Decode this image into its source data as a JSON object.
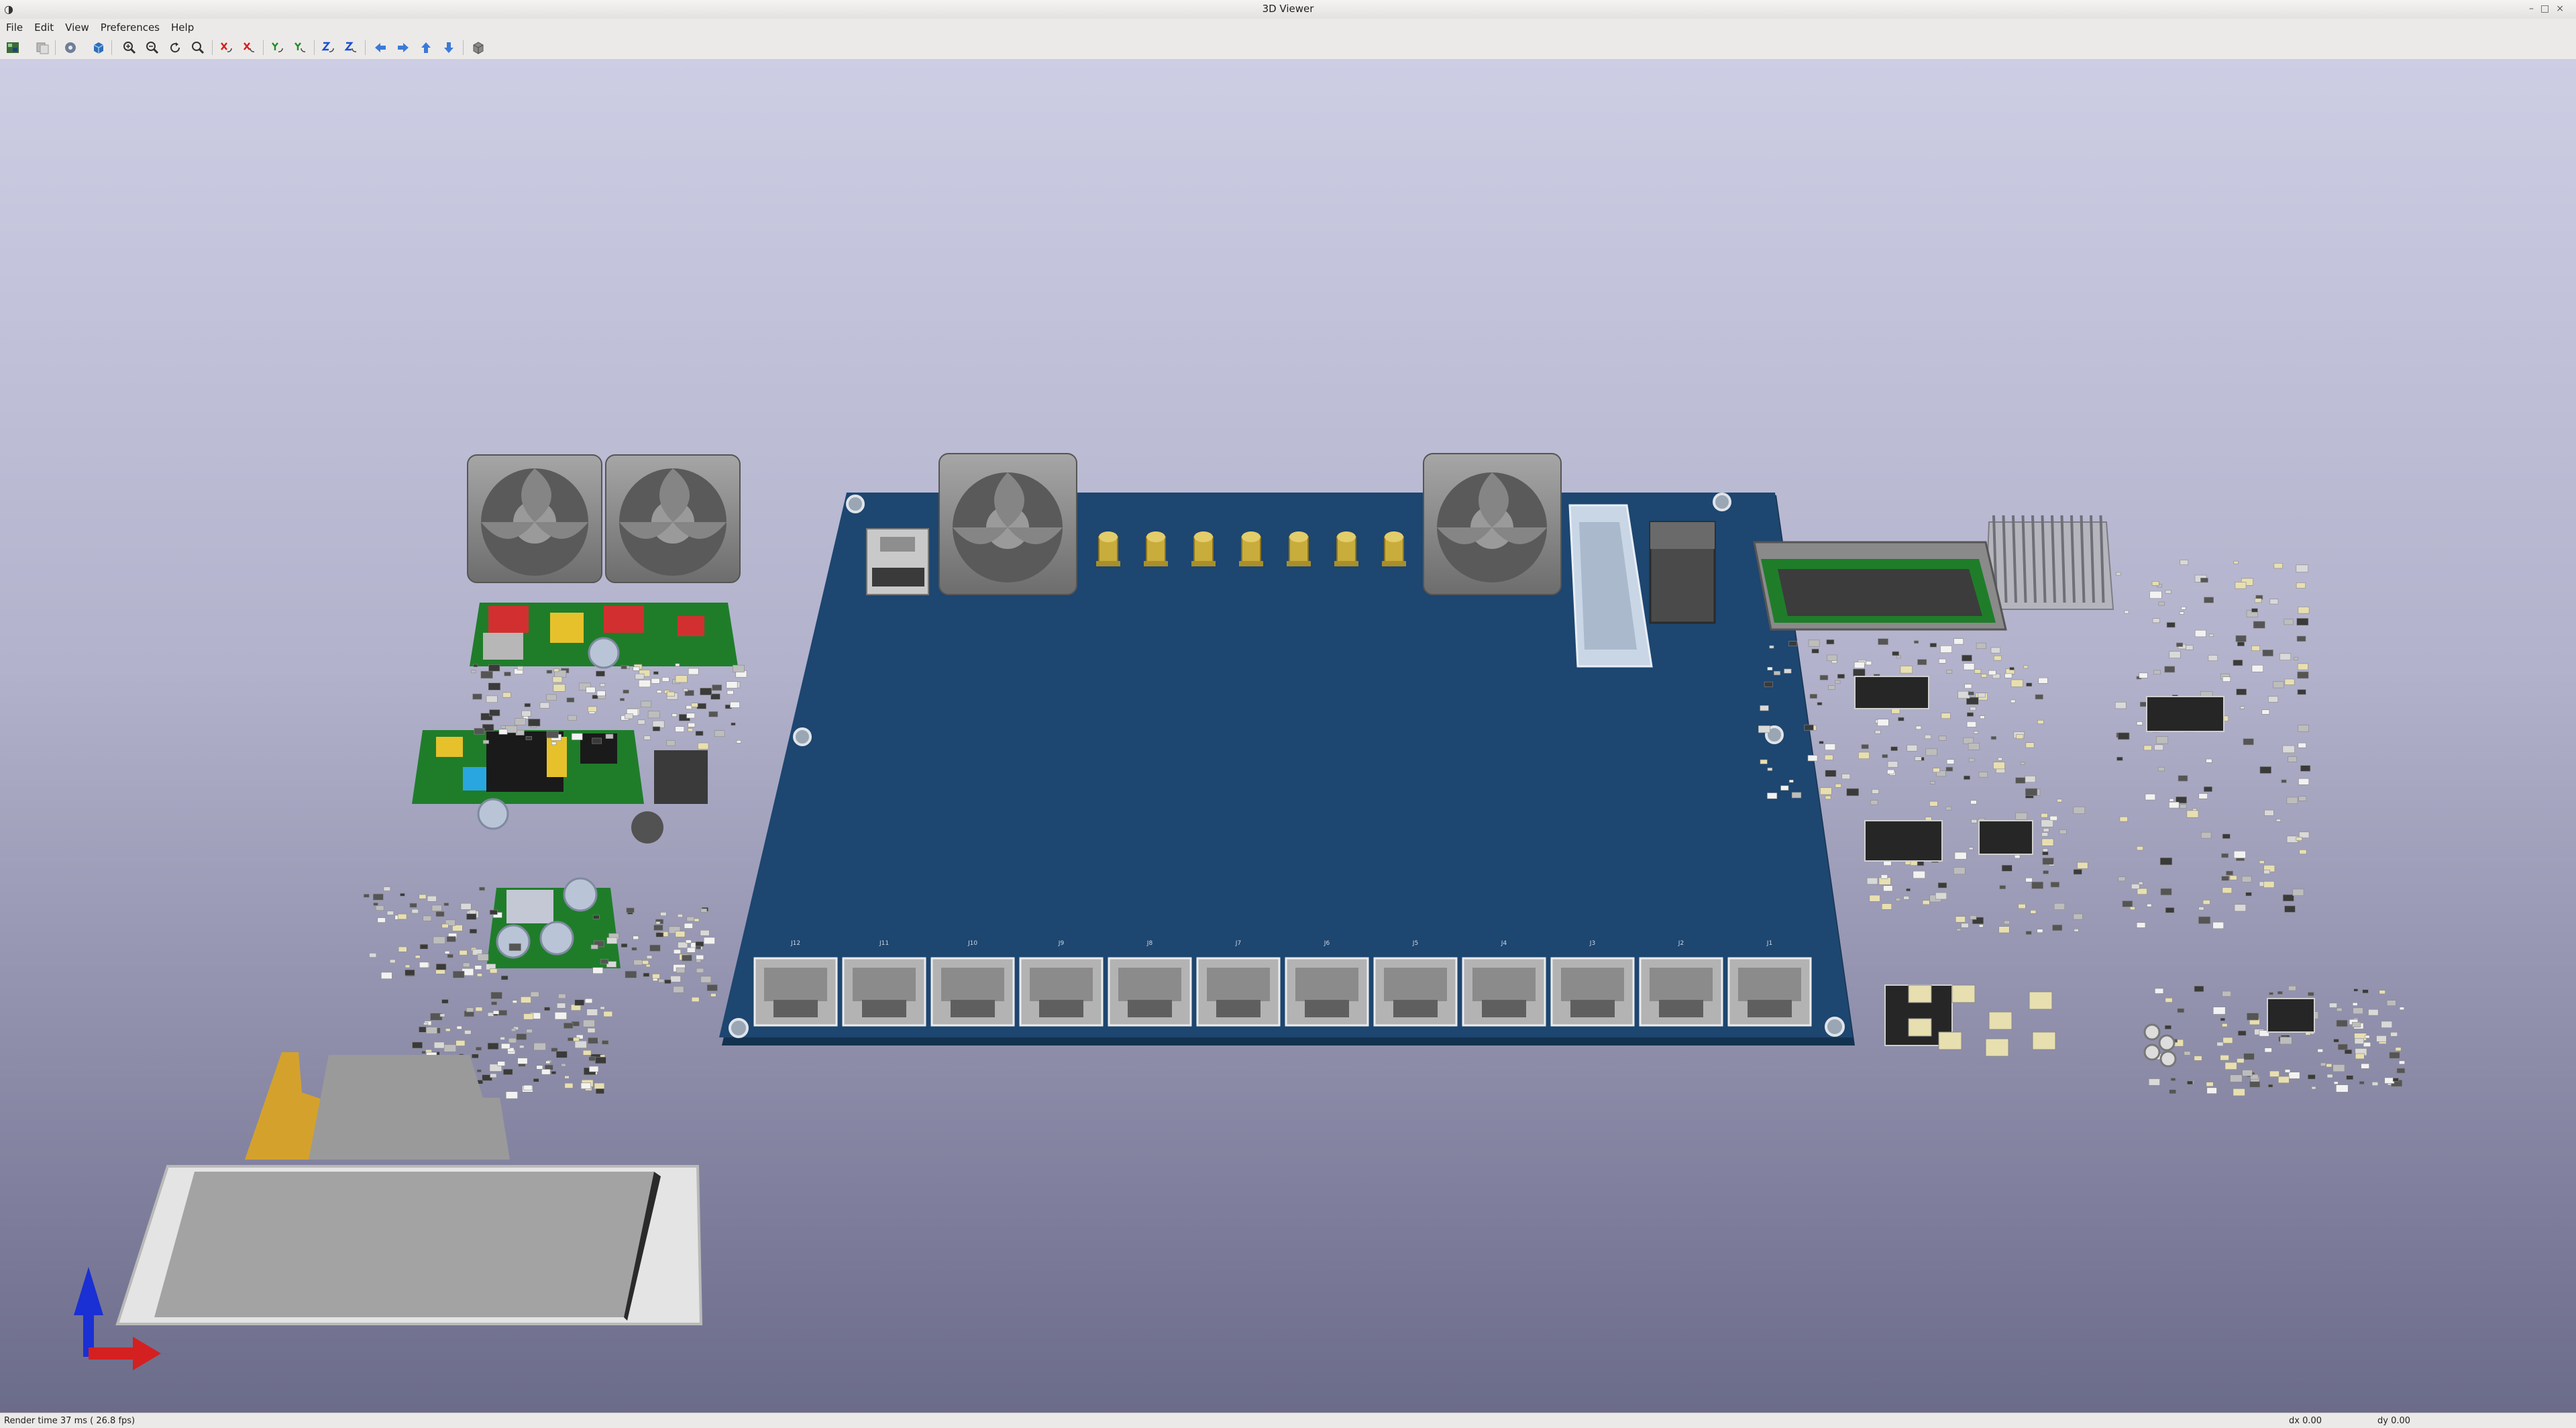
{
  "window": {
    "title": "3D Viewer"
  },
  "menu": [
    "File",
    "Edit",
    "View",
    "Preferences",
    "Help"
  ],
  "toolbar": {
    "buttons": [
      {
        "name": "render-raytracing-icon"
      },
      {
        "name": "copy-image-icon"
      },
      {
        "name": "settings-gear-icon"
      },
      {
        "name": "display-options-icon"
      },
      {
        "name": "zoom-in-icon"
      },
      {
        "name": "zoom-out-icon"
      },
      {
        "name": "redraw-icon"
      },
      {
        "name": "zoom-fit-icon"
      },
      {
        "name": "rotate-x-cw-icon"
      },
      {
        "name": "rotate-x-ccw-icon"
      },
      {
        "name": "rotate-y-cw-icon"
      },
      {
        "name": "rotate-y-ccw-icon"
      },
      {
        "name": "rotate-z-cw-icon"
      },
      {
        "name": "rotate-z-ccw-icon"
      },
      {
        "name": "pan-left-icon"
      },
      {
        "name": "pan-right-icon"
      },
      {
        "name": "pan-up-icon"
      },
      {
        "name": "pan-down-icon"
      },
      {
        "name": "ortho-toggle-icon"
      }
    ]
  },
  "connectors": [
    "J12",
    "J11",
    "J10",
    "J9",
    "J8",
    "J7",
    "J6",
    "J5",
    "J4",
    "J3",
    "J2",
    "J1"
  ],
  "colors": {
    "pcb": "#1d4670",
    "pcb_edge": "#13324f",
    "fan": "#8f8f8f",
    "sma_gold": "#c9ad3c",
    "component_green": "#1f7d2a",
    "flex_cable": "#d4a22c",
    "axis_x": "#d42020",
    "axis_y": "#1a2fd4"
  },
  "status": {
    "render_time": "Render time 37 ms ( 26.8 fps)",
    "dx": "dx 0.00",
    "dy": "dy 0.00"
  }
}
